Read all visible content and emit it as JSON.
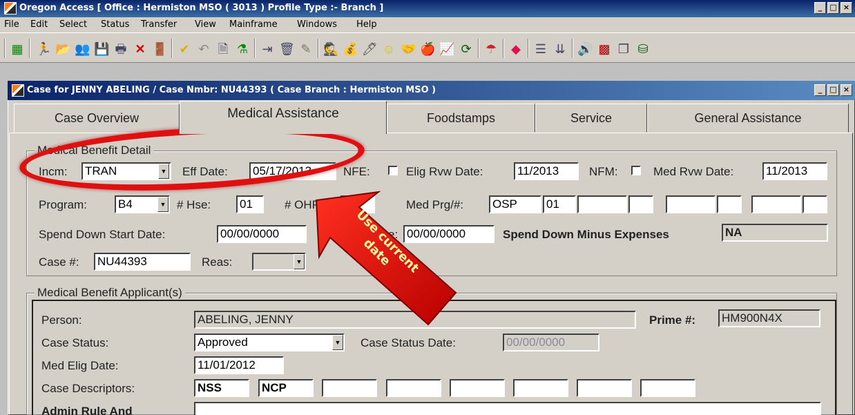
{
  "window": {
    "title": "Oregon Access [ Office : Hermiston MSO ( 3013 ) Profile Type :- Branch ]",
    "btn_min": "_",
    "btn_max": "□",
    "btn_close": "×"
  },
  "menu": [
    "File",
    "Edit",
    "Select",
    "Status",
    "Transfer",
    "View",
    "Mainframe",
    "Windows",
    "Help"
  ],
  "case_window": {
    "title": "Case for JENNY ABELING / Case Nmbr: NU44393 ( Case Branch : Hermiston MSO )"
  },
  "tabs": [
    "Case Overview",
    "Medical Assistance",
    "Foodstamps",
    "Service",
    "General Assistance"
  ],
  "benefit_detail": {
    "group_label": "Medical Benefit Detail",
    "incm_label": "Incm:",
    "incm_value": "TRAN",
    "eff_date_label": "Eff Date:",
    "eff_date_value": "05/17/2013",
    "nfe_label": "NFE:",
    "elig_rvw_label": "Elig Rvw Date:",
    "elig_rvw_value": "11/2013",
    "nfm_label": "NFM:",
    "med_rvw_label": "Med Rvw Date:",
    "med_rvw_value": "11/2013",
    "program_label": "Program:",
    "program_value": "B4",
    "hse_label": "# Hse:",
    "hse_value": "01",
    "ohp_label": "# OHP:",
    "med_prg_label": "Med Prg/#:",
    "med_prg_value": "OSP",
    "med_prg_num": "01",
    "spend_start_label": "Spend Down Start Date:",
    "spend_start_value": "00/00/0000",
    "spend_end_label": "e:",
    "spend_end_value": "00/00/0000",
    "spend_minus_label": "Spend Down Minus Expenses",
    "spend_minus_value": "NA",
    "case_num_label": "Case #:",
    "case_num_value": "NU44393",
    "reas_label": "Reas:"
  },
  "applicants": {
    "group_label": "Medical Benefit Applicant(s)",
    "person_label": "Person:",
    "person_value": "ABELING, JENNY",
    "prime_label": "Prime #:",
    "prime_value": "HM900N4X",
    "status_label": "Case Status:",
    "status_value": "Approved",
    "status_date_label": "Case Status Date:",
    "status_date_value": "00/00/0000",
    "elig_date_label": "Med Elig Date:",
    "elig_date_value": "11/01/2012",
    "descriptors_label": "Case Descriptors:",
    "descriptors": [
      "NSS",
      "NCP",
      "",
      "",
      "",
      "",
      "",
      "",
      ""
    ],
    "admin_label": "Admin Rule And"
  },
  "annotation": {
    "text": "Use current date",
    "color": "#e01010"
  }
}
